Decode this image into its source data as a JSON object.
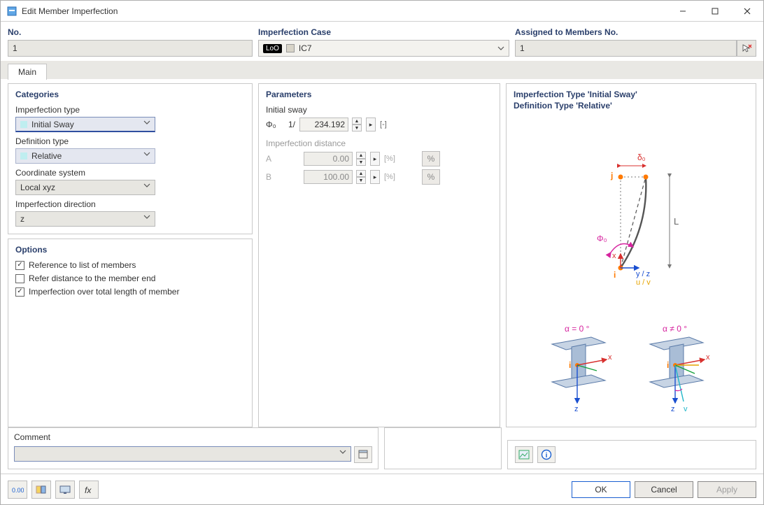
{
  "window": {
    "title": "Edit Member Imperfection"
  },
  "header": {
    "no_label": "No.",
    "no_value": "1",
    "case_label": "Imperfection Case",
    "case_chip": "LoO",
    "case_value": "IC7",
    "assigned_label": "Assigned to Members No.",
    "assigned_value": "1"
  },
  "tabs": {
    "main": "Main"
  },
  "categories": {
    "panel_title": "Categories",
    "imperfection_type_label": "Imperfection type",
    "imperfection_type_value": "Initial Sway",
    "definition_type_label": "Definition type",
    "definition_type_value": "Relative",
    "coord_label": "Coordinate system",
    "coord_value": "Local xyz",
    "direction_label": "Imperfection direction",
    "direction_value": "z"
  },
  "options": {
    "panel_title": "Options",
    "opt1": "Reference to list of members",
    "opt2": "Refer distance to the member end",
    "opt3": "Imperfection over total length of member"
  },
  "parameters": {
    "panel_title": "Parameters",
    "initial_sway_label": "Initial sway",
    "phi_symbol": "Φ₀",
    "one_over": "1/",
    "phi_value": "234.192",
    "phi_unit": "[-]",
    "distance_label": "Imperfection distance",
    "A_label": "A",
    "A_value": "0.00",
    "A_unit": "[%]",
    "B_label": "B",
    "B_value": "100.00",
    "B_unit": "[%]",
    "pct": "%"
  },
  "infopanel": {
    "line1": "Imperfection Type 'Initial Sway'",
    "line2": "Definition Type 'Relative'",
    "diag": {
      "delta0": "δ₀",
      "phi0": "Φ₀",
      "j": "j",
      "i": "i",
      "x": "x",
      "yz": "y / z",
      "uv": "u / v",
      "L": "L",
      "z": "z",
      "v": "v",
      "alpha0": "α = 0 °",
      "alpha_ne": "α ≠ 0 °"
    }
  },
  "comment": {
    "panel_title": "Comment",
    "value": ""
  },
  "buttons": {
    "ok": "OK",
    "cancel": "Cancel",
    "apply": "Apply"
  }
}
